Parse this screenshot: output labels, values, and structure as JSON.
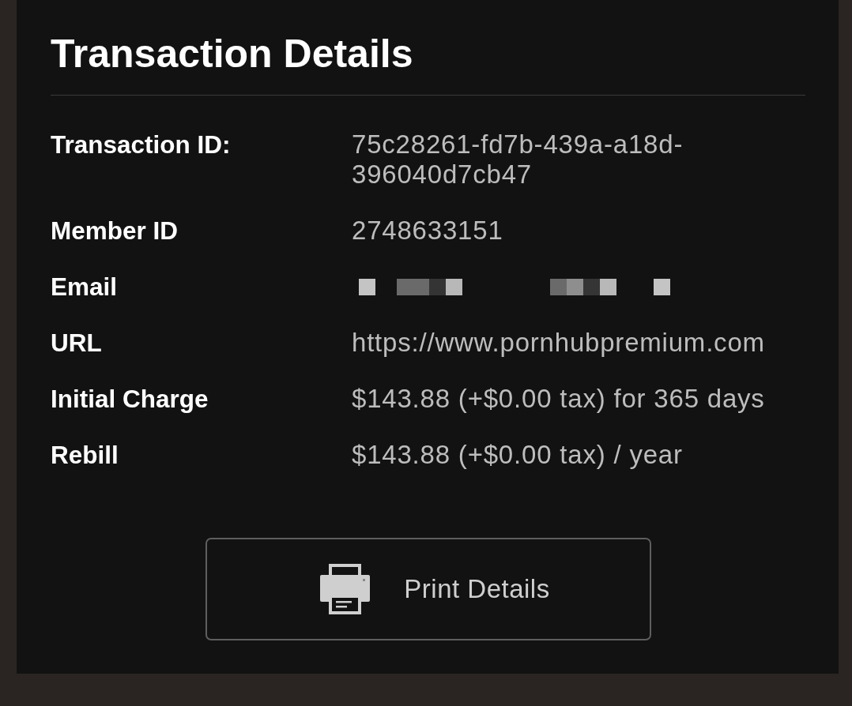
{
  "card": {
    "title": "Transaction Details"
  },
  "details": [
    {
      "label": "Transaction ID:",
      "kind": "text",
      "value": "75c28261-fd7b-439a-a18d-396040d7cb47"
    },
    {
      "label": "Member ID",
      "kind": "text",
      "value": "2748633151"
    },
    {
      "label": "Email",
      "kind": "redacted"
    },
    {
      "label": "URL",
      "kind": "text",
      "value": "https://www.pornhubpremium.com"
    },
    {
      "label": "Initial Charge",
      "kind": "text",
      "value": "$143.88 (+$0.00 tax) for 365 days"
    },
    {
      "label": "Rebill",
      "kind": "text",
      "value": "$143.88 (+$0.00 tax) / year"
    }
  ],
  "print_button": {
    "label": "Print Details"
  }
}
